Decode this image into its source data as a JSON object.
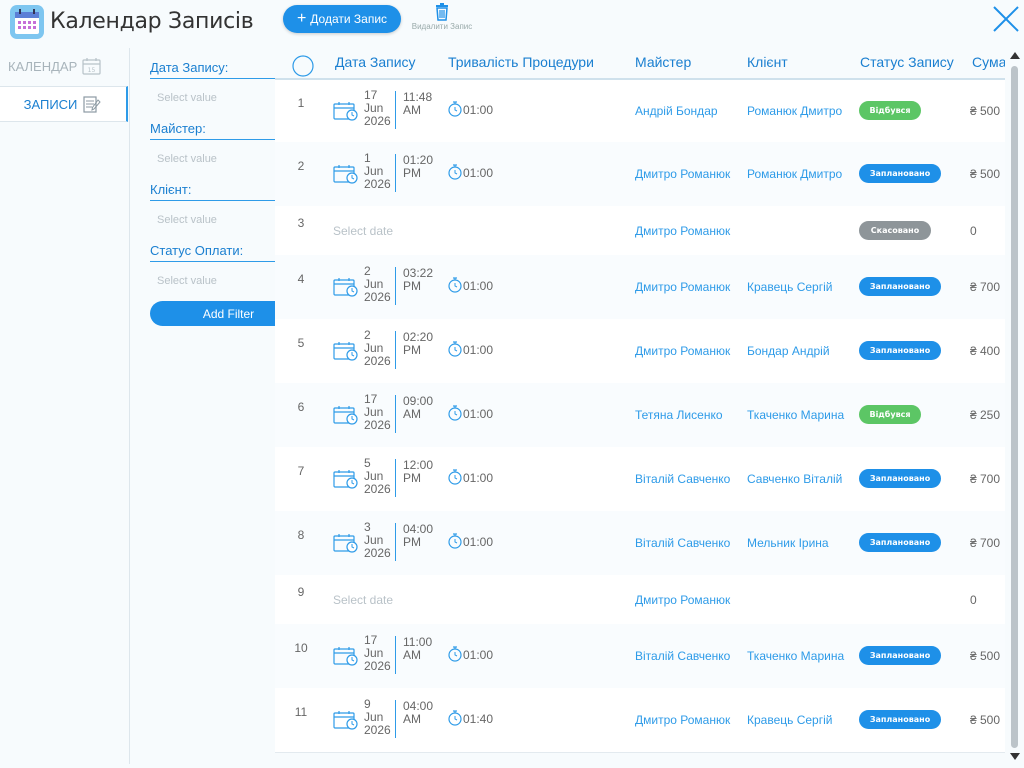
{
  "app": {
    "title": "Календар Записів"
  },
  "toolbar": {
    "add_label": "Додати Запис",
    "delete_label": "Видалити Запис"
  },
  "nav": {
    "calendar": "КАЛЕНДАР",
    "records": "ЗАПИСИ",
    "calendar_icon_day": "15"
  },
  "filters": {
    "items": [
      {
        "label": "Дата Запису:",
        "placeholder": "Select value"
      },
      {
        "label": "Майстер:",
        "placeholder": "Select value"
      },
      {
        "label": "Клієнт:",
        "placeholder": "Select value"
      },
      {
        "label": "Статус Оплати:",
        "placeholder": "Select value"
      }
    ],
    "add_filter": "Add Filter"
  },
  "table": {
    "headers": [
      "Дата Запису",
      "Тривалість Процедури",
      "Майстер",
      "Клієнт",
      "Статус Запису",
      "Сума"
    ],
    "rows": [
      {
        "n": "1",
        "day": "17",
        "month": "Jun",
        "year": "2026",
        "time": "11:48",
        "ampm": "AM",
        "duration": "01:00",
        "master": "Андрій Бондар",
        "client": "Романюк Дмитро",
        "status": "Відбувся",
        "sum": "₴ 500"
      },
      {
        "n": "2",
        "day": "1",
        "month": "Jun",
        "year": "2026",
        "time": "01:20",
        "ampm": "PM",
        "duration": "01:00",
        "master": "Дмитро Романюк",
        "client": "Романюк Дмитро",
        "status": "Заплановано",
        "sum": "₴ 500"
      },
      {
        "n": "3",
        "date_placeholder": "Select date",
        "master": "Дмитро Романюк",
        "status": "Скасовано",
        "sum": "0"
      },
      {
        "n": "4",
        "day": "2",
        "month": "Jun",
        "year": "2026",
        "time": "03:22",
        "ampm": "PM",
        "duration": "01:00",
        "master": "Дмитро Романюк",
        "client": "Кравець Сергій",
        "status": "Заплановано",
        "sum": "₴ 700"
      },
      {
        "n": "5",
        "day": "2",
        "month": "Jun",
        "year": "2026",
        "time": "02:20",
        "ampm": "PM",
        "duration": "01:00",
        "master": "Дмитро Романюк",
        "client": "Бондар Андрій",
        "status": "Заплановано",
        "sum": "₴ 400"
      },
      {
        "n": "6",
        "day": "17",
        "month": "Jun",
        "year": "2026",
        "time": "09:00",
        "ampm": "AM",
        "duration": "01:00",
        "master": "Тетяна Лисенко",
        "client": "Ткаченко Марина",
        "status": "Відбувся",
        "sum": "₴ 250"
      },
      {
        "n": "7",
        "day": "5",
        "month": "Jun",
        "year": "2026",
        "time": "12:00",
        "ampm": "PM",
        "duration": "01:00",
        "master": "Віталій Савченко",
        "client": "Савченко Віталій",
        "status": "Заплановано",
        "sum": "₴ 700"
      },
      {
        "n": "8",
        "day": "3",
        "month": "Jun",
        "year": "2026",
        "time": "04:00",
        "ampm": "PM",
        "duration": "01:00",
        "master": "Віталій Савченко",
        "client": "Мельник Ірина",
        "status": "Заплановано",
        "sum": "₴ 700"
      },
      {
        "n": "9",
        "date_placeholder": "Select date",
        "master": "Дмитро Романюк",
        "sum": "0"
      },
      {
        "n": "10",
        "day": "17",
        "month": "Jun",
        "year": "2026",
        "time": "11:00",
        "ampm": "AM",
        "duration": "01:00",
        "master": "Віталій Савченко",
        "client": "Ткаченко Марина",
        "status": "Заплановано",
        "sum": "₴ 500"
      },
      {
        "n": "11",
        "day": "9",
        "month": "Jun",
        "year": "2026",
        "time": "04:00",
        "ampm": "AM",
        "duration": "01:40",
        "master": "Дмитро Романюк",
        "client": "Кравець Сергій",
        "status": "Заплановано",
        "sum": "₴ 500"
      }
    ]
  },
  "colors": {
    "accent": "#1e90e8",
    "done": "#5cc665",
    "planned": "#1e90e8",
    "cancelled": "#8e9599"
  },
  "icons": [
    "calendar-app-icon",
    "plus-icon",
    "trash-icon",
    "close-icon",
    "calendar-icon",
    "notepad-icon",
    "chevron-up-icon",
    "select-all-circle-icon",
    "stopwatch-icon"
  ]
}
